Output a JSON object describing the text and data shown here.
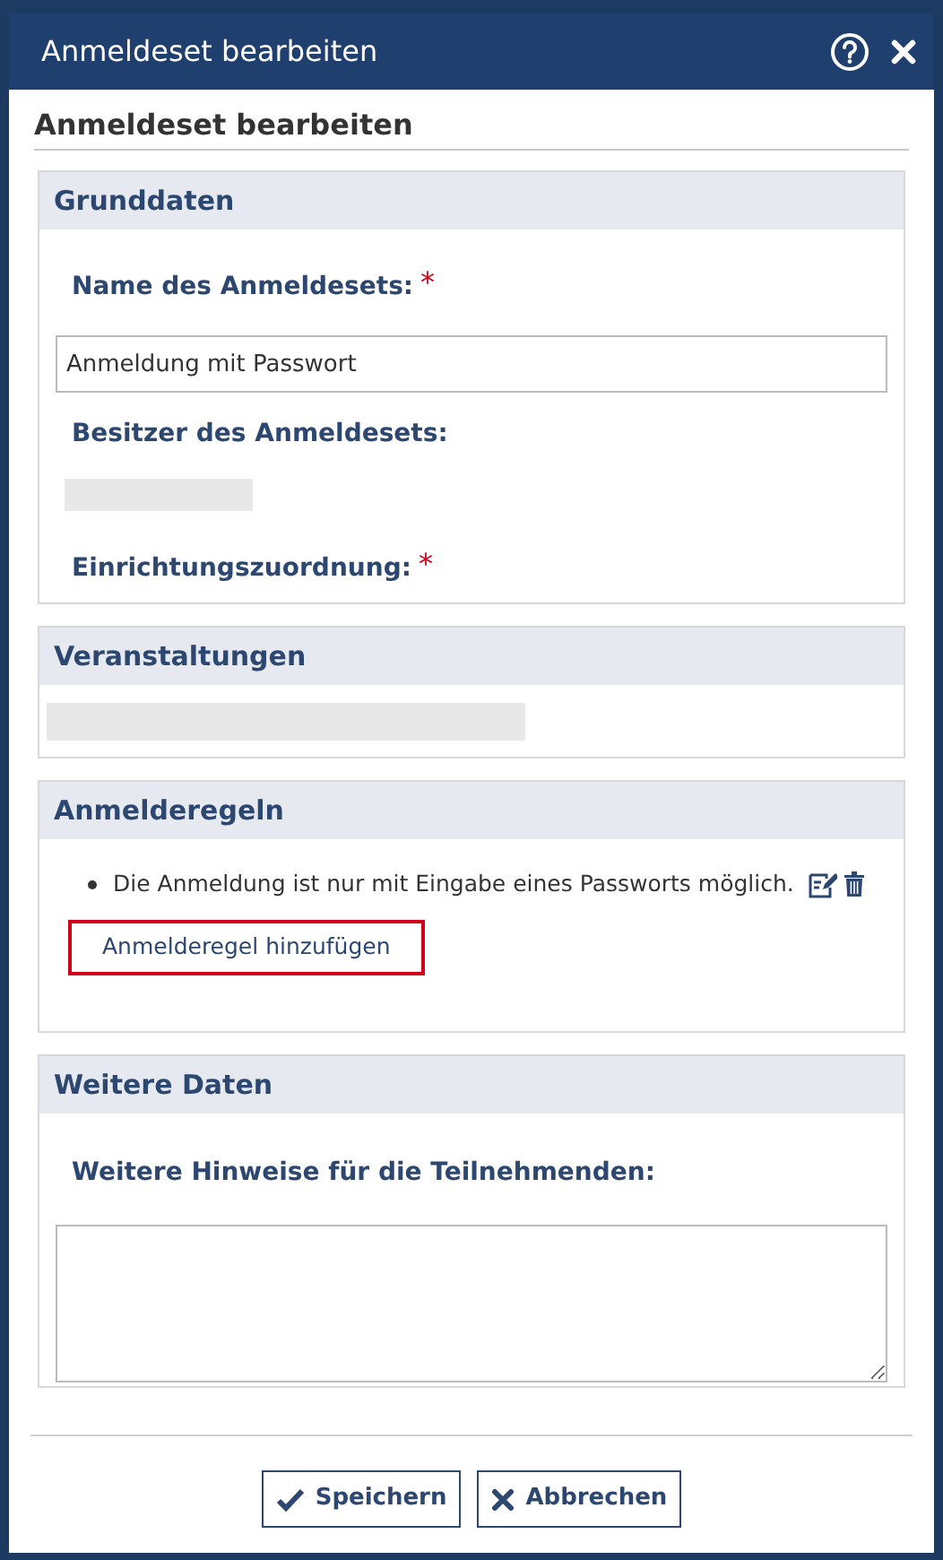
{
  "window": {
    "title": "Anmeldeset bearbeiten"
  },
  "heading": "Anmeldeset bearbeiten",
  "grunddaten": {
    "title": "Grunddaten",
    "name_label": "Name des Anmeldesets:",
    "name_required_mark": "*",
    "name_value": "Anmeldung mit Passwort",
    "owner_label": "Besitzer des Anmeldesets:",
    "assignment_label": "Einrichtungszuordnung:",
    "assignment_required_mark": "*"
  },
  "veranstaltungen": {
    "title": "Veranstaltungen"
  },
  "anmelderegeln": {
    "title": "Anmelderegeln",
    "rules": [
      "Die Anmeldung ist nur mit Eingabe eines Passworts möglich."
    ],
    "add_link": "Anmelderegel hinzufügen",
    "add_link_highlighted": true
  },
  "weitere_daten": {
    "title": "Weitere Daten",
    "notes_label": "Weitere Hinweise für die Teilnehmenden:"
  },
  "buttons": [
    {
      "kind": "save",
      "label": "Speichern"
    },
    {
      "kind": "cancel",
      "label": "Abbrechen"
    }
  ]
}
